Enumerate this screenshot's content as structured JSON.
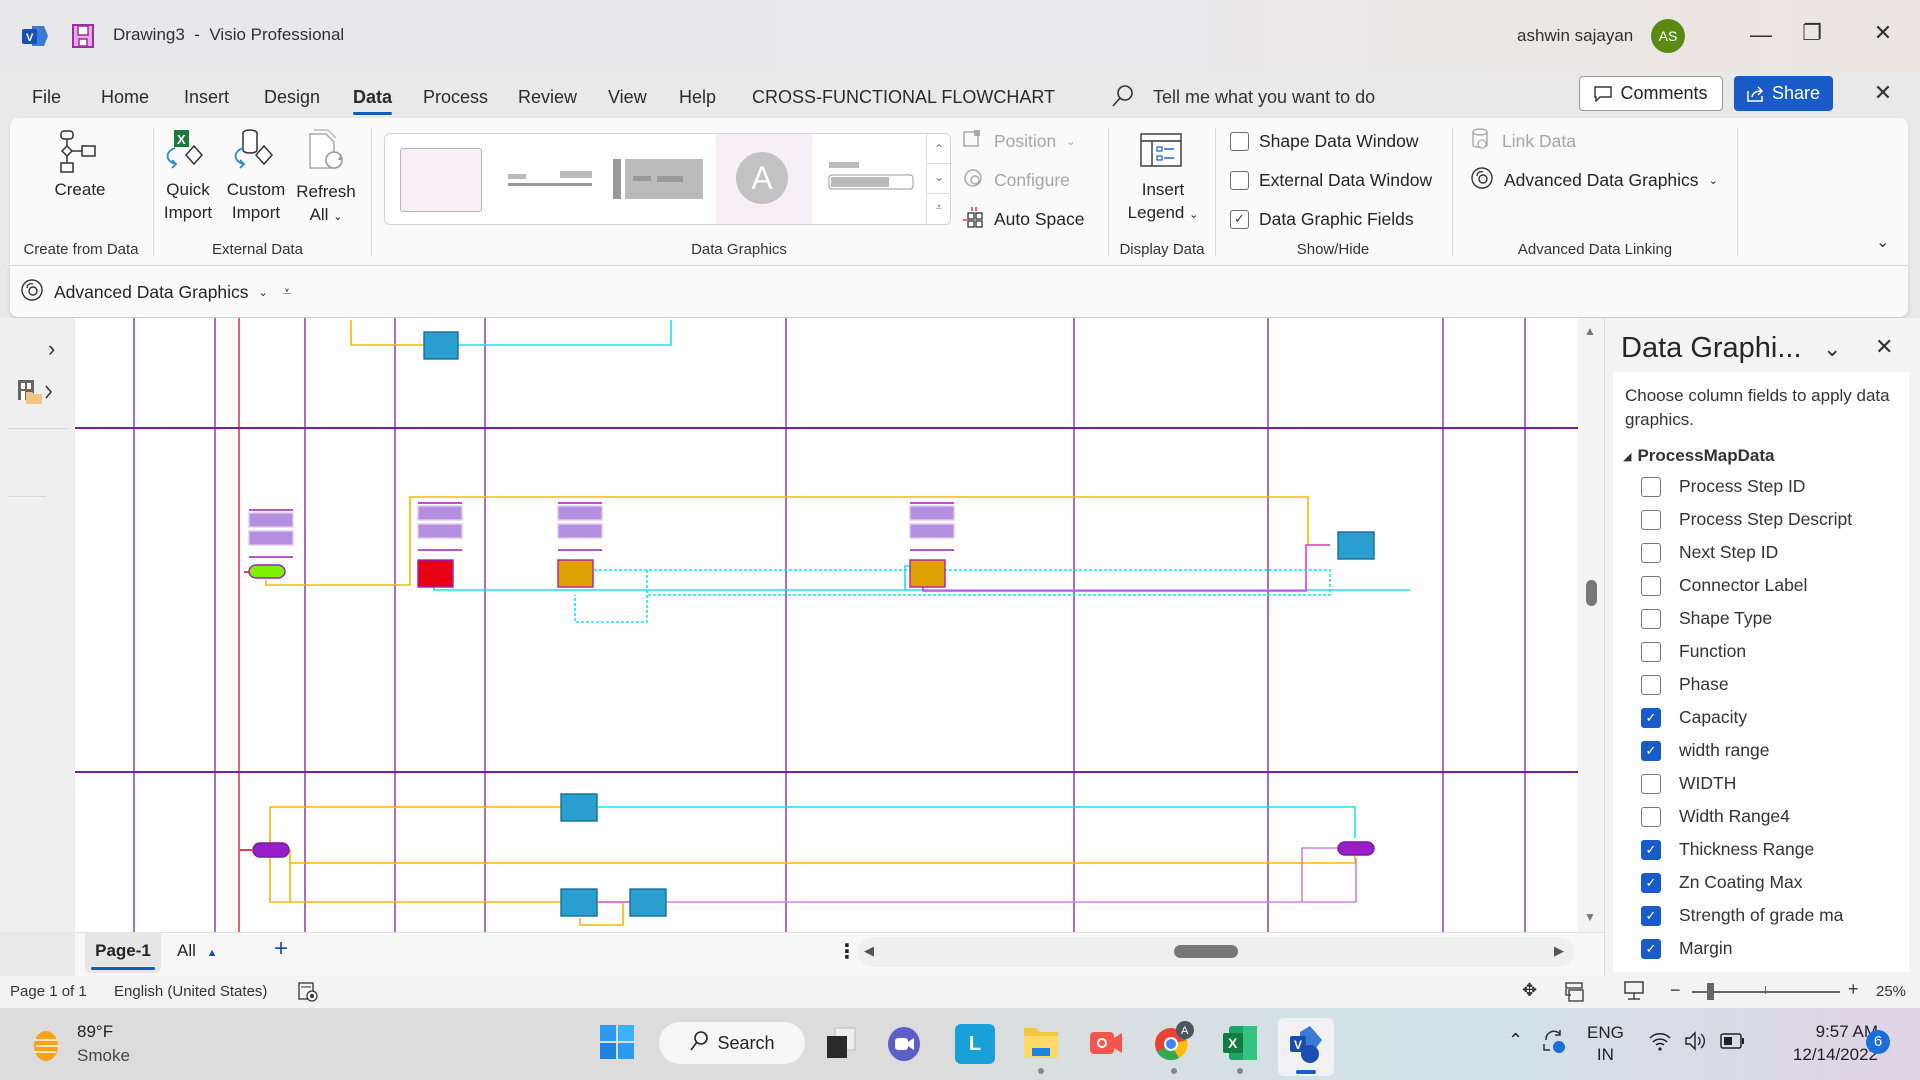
{
  "titlebar": {
    "document_name": "Drawing3",
    "separator": "-",
    "app_name": "Visio Professional",
    "user_name": "ashwin sajayan",
    "user_initials": "AS",
    "avatar_color": "#5a8a14",
    "minimize": "—",
    "restore": "❐",
    "close": "✕"
  },
  "menu": {
    "tabs": [
      {
        "label": "File"
      },
      {
        "label": "Home"
      },
      {
        "label": "Insert"
      },
      {
        "label": "Design"
      },
      {
        "label": "Data",
        "active": true
      },
      {
        "label": "Process"
      },
      {
        "label": "Review"
      },
      {
        "label": "View"
      },
      {
        "label": "Help"
      },
      {
        "label": "CROSS-FUNCTIONAL FLOWCHART"
      }
    ],
    "search_placeholder": "Tell me what you want to do",
    "comments_label": "Comments",
    "share_label": "Share",
    "close_ribbon": "✕",
    "accent": "#1a5cc7"
  },
  "ribbon": {
    "create_from_data": {
      "create_label": "Create",
      "group_label": "Create from Data"
    },
    "external_data": {
      "quick_import_1": "Quick",
      "quick_import_2": "Import",
      "custom_import_1": "Custom",
      "custom_import_2": "Import",
      "refresh_1": "Refresh",
      "refresh_2": "All",
      "group_label": "External Data"
    },
    "data_graphics": {
      "position_label": "Position",
      "configure_label": "Configure",
      "auto_space_label": "Auto Space",
      "gallery_letter": "A",
      "group_label": "Data Graphics"
    },
    "display_data": {
      "insert_1": "Insert",
      "insert_2": "Legend",
      "group_label": "Display Data"
    },
    "show_hide": {
      "items": [
        {
          "label": "Shape Data Window",
          "checked": false
        },
        {
          "label": "External Data Window",
          "checked": false
        },
        {
          "label": "Data Graphic Fields",
          "checked": true
        }
      ],
      "group_label": "Show/Hide"
    },
    "advanced_linking": {
      "link_data_label": "Link Data",
      "adv_graphics_label": "Advanced Data Graphics",
      "group_label": "Advanced Data Linking"
    }
  },
  "subribbon": {
    "adv_graphics_label": "Advanced Data Graphics"
  },
  "pages": {
    "tabs": [
      {
        "label": "Page-1",
        "active": true
      }
    ],
    "all_label": "All",
    "add_label": "+"
  },
  "status": {
    "page_info": "Page 1 of 1",
    "language": "English (United States)",
    "zoom_level": "25%",
    "zoom_fraction": 0.1
  },
  "panel": {
    "title": "Data Graphi...",
    "description": "Choose column fields to apply data graphics.",
    "group_name": "ProcessMapData",
    "fields": [
      {
        "label": "Process Step ID",
        "checked": false
      },
      {
        "label": "Process Step Descript",
        "checked": false
      },
      {
        "label": "Next Step ID",
        "checked": false
      },
      {
        "label": "Connector Label",
        "checked": false
      },
      {
        "label": "Shape Type",
        "checked": false
      },
      {
        "label": "Function",
        "checked": false
      },
      {
        "label": "Phase",
        "checked": false
      },
      {
        "label": "Capacity",
        "checked": true
      },
      {
        "label": "width range",
        "checked": true
      },
      {
        "label": "WIDTH",
        "checked": false
      },
      {
        "label": "Width Range4",
        "checked": false
      },
      {
        "label": "Thickness Range",
        "checked": true
      },
      {
        "label": "Zn Coating Max",
        "checked": true
      },
      {
        "label": "Strength of grade ma",
        "checked": true
      },
      {
        "label": "Margin",
        "checked": true
      }
    ]
  },
  "taskbar": {
    "weather_temp": "89°F",
    "weather_desc": "Smoke",
    "search_label": "Search",
    "lang_1": "ENG",
    "lang_2": "IN",
    "time": "9:57 AM",
    "date": "12/14/2022",
    "notification_count": "6"
  },
  "diagram": {
    "lane_color": "#7b1fa2",
    "colors": {
      "yellow": "#f5b800",
      "cyan": "#19e3f0",
      "magenta": "#e040d8",
      "lilac": "#d080e8",
      "blue_shape": "#2b9fd0",
      "red_shape": "#e60012",
      "orange_shape": "#e0a200",
      "green_shape": "#7cf000",
      "purple_shape": "#9a1ec8"
    }
  }
}
